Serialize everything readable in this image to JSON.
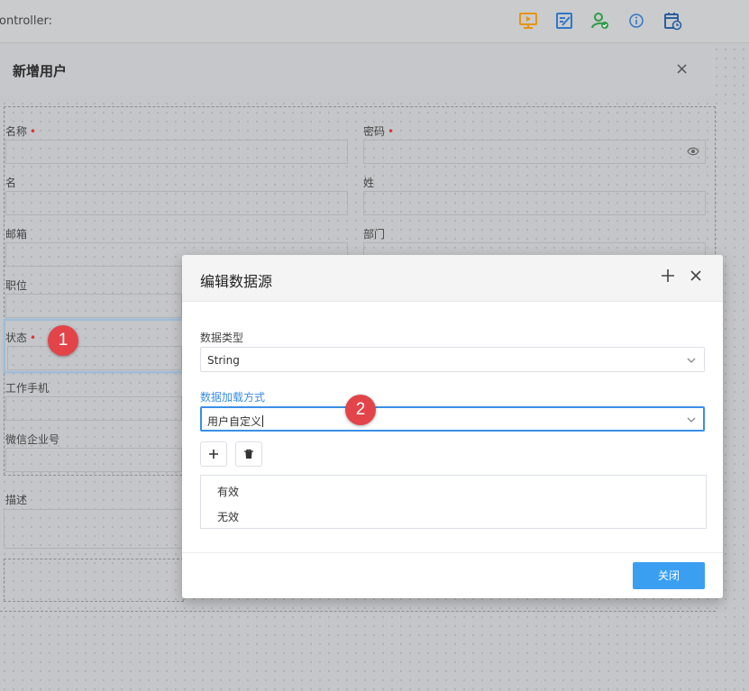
{
  "topbar": {
    "controller_label": "ontroller:",
    "icons": [
      "monitor-play-icon",
      "edit-icon",
      "user-check-icon",
      "info-icon",
      "calendar-clock-icon"
    ]
  },
  "outer_dialog": {
    "title": "新增用户",
    "close": "×",
    "fields": {
      "name": "名称",
      "password": "密码",
      "first_name": "名",
      "last_name": "姓",
      "email": "邮箱",
      "department": "部门",
      "position": "职位",
      "status": "状态",
      "work_phone": "工作手机",
      "wechat": "微信企业号",
      "description": "描述"
    },
    "required_mark": "•"
  },
  "badges": [
    "1",
    "2"
  ],
  "modal": {
    "title": "编辑数据源",
    "data_type_label": "数据类型",
    "data_type_value": "String",
    "load_mode_label": "数据加载方式",
    "load_mode_value": "用户自定义",
    "items": [
      "有效",
      "无效"
    ],
    "close_button": "关闭"
  },
  "colors": {
    "accent": "#3a9ff0",
    "badge": "#e2444a",
    "required": "#dd3333"
  }
}
